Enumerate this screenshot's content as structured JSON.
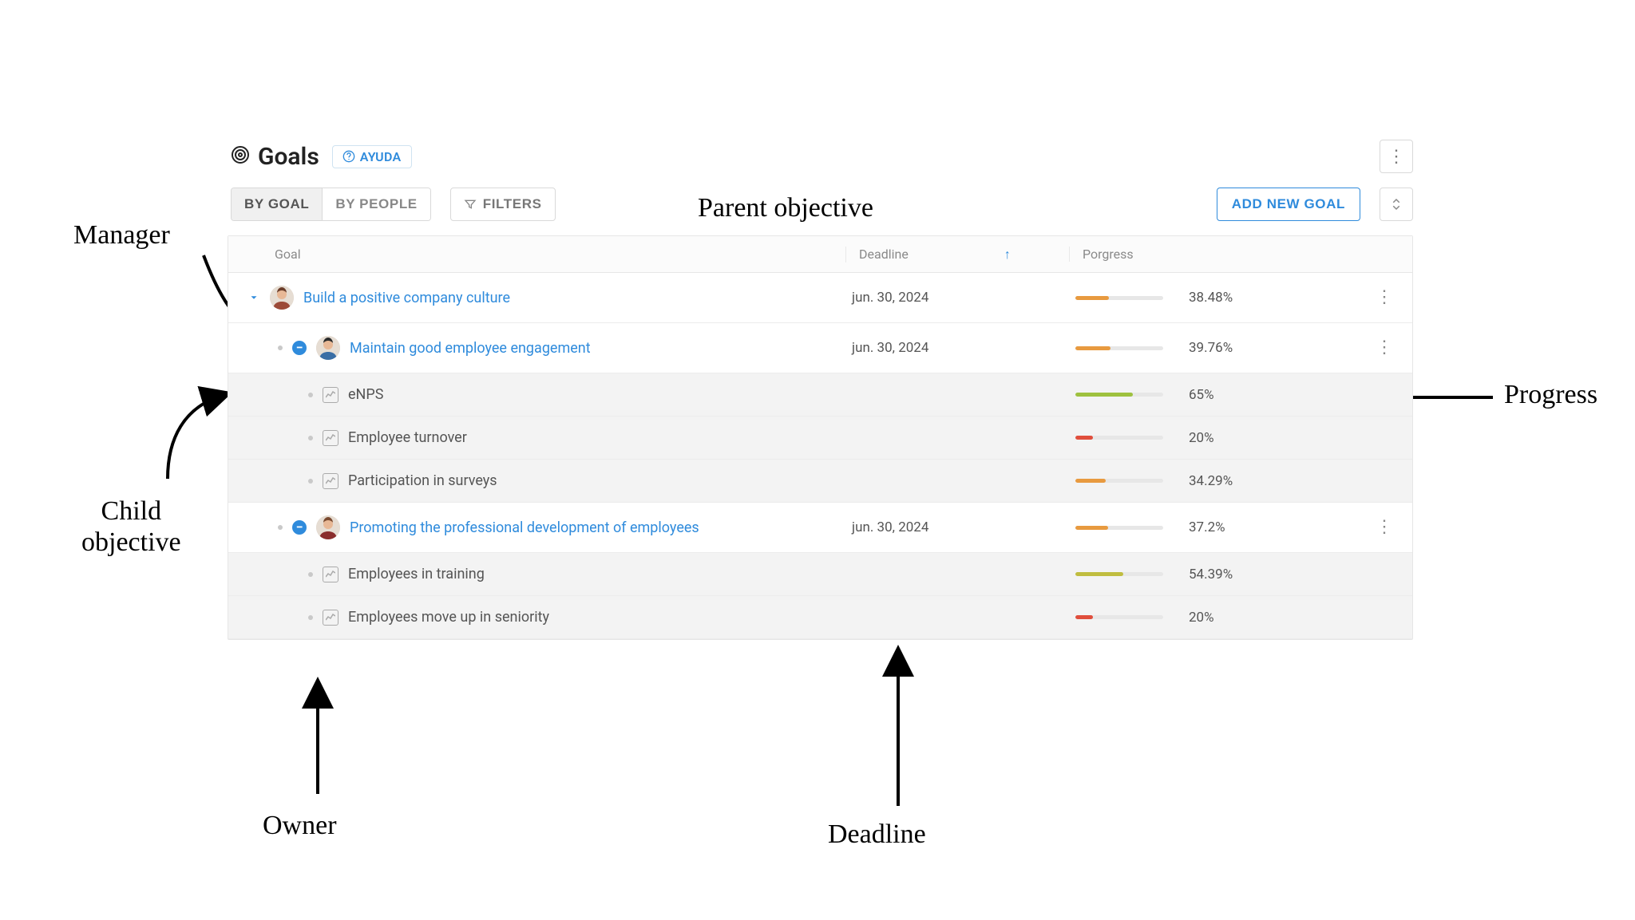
{
  "header": {
    "title": "Goals",
    "help_label": "AYUDA"
  },
  "toolbar": {
    "tab_by_goal": "BY GOAL",
    "tab_by_people": "BY PEOPLE",
    "filters_label": "FILTERS",
    "add_goal_label": "ADD NEW GOAL"
  },
  "columns": {
    "goal": "Goal",
    "deadline": "Deadline",
    "progress": "Porgress"
  },
  "colors": {
    "orange": "#e89a3f",
    "green": "#9ec13f",
    "yellowgreen": "#c0bd3f",
    "red": "#e04e3c"
  },
  "rows": [
    {
      "type": "objective",
      "depth": 0,
      "title": "Build a positive company culture",
      "link": true,
      "deadline": "jun. 30, 2024",
      "percent": "38.48%",
      "fill": 38.48,
      "color": "orange",
      "avatar": 1,
      "toggle": "chevron",
      "bg": "white"
    },
    {
      "type": "objective",
      "depth": 1,
      "title": "Maintain good employee engagement",
      "link": true,
      "deadline": "jun. 30, 2024",
      "percent": "39.76%",
      "fill": 39.76,
      "color": "orange",
      "avatar": 2,
      "toggle": "minus",
      "bg": "white"
    },
    {
      "type": "kr",
      "depth": 2,
      "title": "eNPS",
      "percent": "65%",
      "fill": 65,
      "color": "green",
      "bg": "shade"
    },
    {
      "type": "kr",
      "depth": 2,
      "title": "Employee turnover",
      "percent": "20%",
      "fill": 20,
      "color": "red",
      "bg": "shade"
    },
    {
      "type": "kr",
      "depth": 2,
      "title": "Participation in surveys",
      "percent": "34.29%",
      "fill": 34.29,
      "color": "orange",
      "bg": "shade"
    },
    {
      "type": "objective",
      "depth": 1,
      "title": "Promoting the professional development of employees",
      "link": true,
      "deadline": "jun. 30, 2024",
      "percent": "37.2%",
      "fill": 37.2,
      "color": "orange",
      "avatar": 3,
      "toggle": "minus",
      "bg": "white"
    },
    {
      "type": "kr",
      "depth": 2,
      "title": "Employees in training",
      "percent": "54.39%",
      "fill": 54.39,
      "color": "yellowgreen",
      "bg": "shade"
    },
    {
      "type": "kr",
      "depth": 2,
      "title": "Employees move up in seniority",
      "percent": "20%",
      "fill": 20,
      "color": "red",
      "bg": "shade"
    }
  ],
  "callouts": {
    "manager": "Manager",
    "parent": "Parent objective",
    "child": "Child\nobjective",
    "owner": "Owner",
    "deadline": "Deadline",
    "progress": "Progress"
  }
}
